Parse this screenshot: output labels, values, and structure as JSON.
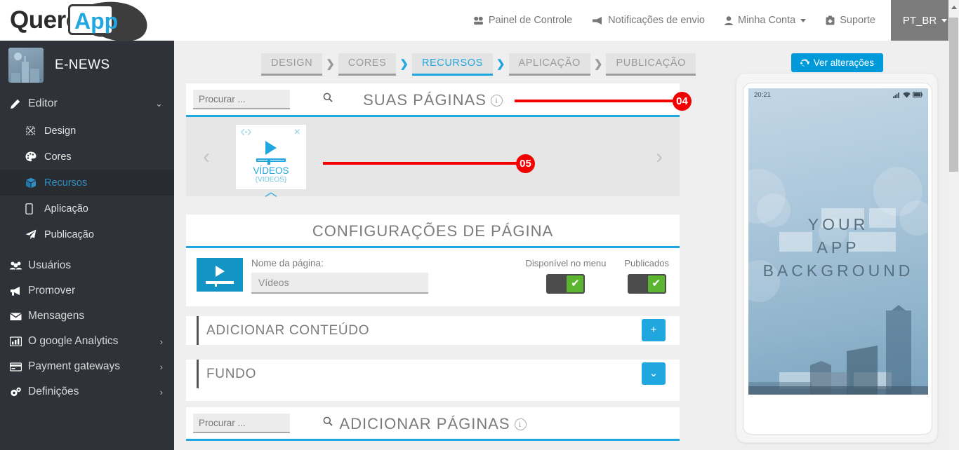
{
  "brand": {
    "name_part1": "Quero",
    "name_part2": "App"
  },
  "topnav": {
    "items": [
      {
        "label": "Painel de Controle",
        "icon": "dashboard-icon"
      },
      {
        "label": "Notificações de envio",
        "icon": "megaphone-icon"
      },
      {
        "label": "Minha Conta",
        "icon": "user-icon",
        "caret": true
      },
      {
        "label": "Suporte",
        "icon": "lifebuoy-icon"
      }
    ],
    "language": "PT_BR"
  },
  "sidebar": {
    "app_name": "E-NEWS",
    "editor": {
      "label": "Editor",
      "icon": "pencil-icon"
    },
    "editor_items": [
      {
        "label": "Design",
        "icon": "design-icon",
        "active": false
      },
      {
        "label": "Cores",
        "icon": "palette-icon",
        "active": false
      },
      {
        "label": "Recursos",
        "icon": "box-icon",
        "active": true
      },
      {
        "label": "Aplicação",
        "icon": "mobile-icon",
        "active": false
      },
      {
        "label": "Publicação",
        "icon": "paper-plane-icon",
        "active": false
      }
    ],
    "items": [
      {
        "label": "Usuários",
        "icon": "users-icon",
        "arrow": false
      },
      {
        "label": "Promover",
        "icon": "bullhorn-icon",
        "arrow": false
      },
      {
        "label": "Mensagens",
        "icon": "envelope-icon",
        "arrow": false
      },
      {
        "label": "O google Analytics",
        "icon": "chart-icon",
        "arrow": true
      },
      {
        "label": "Payment gateways",
        "icon": "credit-card-icon",
        "arrow": true
      },
      {
        "label": "Definições",
        "icon": "gears-icon",
        "arrow": true
      }
    ]
  },
  "steps": [
    {
      "label": "DESIGN",
      "active": false
    },
    {
      "label": "CORES",
      "active": false
    },
    {
      "label": "RECURSOS",
      "active": true
    },
    {
      "label": "APLICAÇÃO",
      "active": false
    },
    {
      "label": "PUBLICAÇÃO",
      "active": false
    }
  ],
  "toolbar": {
    "view_changes_label": "Ver alterações",
    "view_changes_icon": "refresh-icon"
  },
  "your_pages": {
    "title": "SUAS PÁGINAS",
    "info_icon": "info-icon",
    "search_placeholder": "Procurar ...",
    "search_value": "",
    "search_icon": "search-icon",
    "prev_icon": "chevron-left-icon",
    "next_icon": "chevron-right-icon",
    "cards": [
      {
        "name": "VÍDEOS",
        "sub": "(VIDEOS)",
        "icon": "video-play-icon",
        "code_icon": "code-icon",
        "close_icon": "close-icon",
        "selected": true
      }
    ]
  },
  "page_settings": {
    "title": "CONFIGURAÇÕES DE PÁGINA",
    "thumb_icon": "video-play-icon",
    "name_label": "Nome da página:",
    "name_value": "Vídeos",
    "name_placeholder": "Nome da página",
    "toggles": [
      {
        "label": "Disponível no menu",
        "checked": true,
        "check_icon": "check-icon"
      },
      {
        "label": "Publicados",
        "checked": true,
        "check_icon": "check-icon"
      }
    ],
    "rows": [
      {
        "label": "ADICIONAR CONTEÚDO",
        "button_icon": "plus-icon",
        "button_glyph": "+"
      },
      {
        "label": "FUNDO",
        "button_icon": "chevron-down-icon",
        "button_glyph": "⌄"
      }
    ]
  },
  "add_pages": {
    "title": "ADICIONAR PÁGINAS",
    "info_icon": "info-icon",
    "search_placeholder": "Procurar ...",
    "search_value": "",
    "search_icon": "search-icon"
  },
  "preview": {
    "status_time": "20:21",
    "signal_icon": "signal-icon",
    "wifi_icon": "wifi-icon",
    "battery_icon": "battery-icon",
    "background_text_lines": [
      "YOUR",
      "APP",
      "BACKGROUND"
    ]
  },
  "annotations": [
    {
      "id": "04",
      "label": "04"
    },
    {
      "id": "05",
      "label": "05"
    }
  ],
  "colors": {
    "accent_blue": "#21a7e0",
    "sidebar_bg": "#2f3238",
    "annotation_red": "#f50000",
    "toggle_green": "#5cb531"
  }
}
